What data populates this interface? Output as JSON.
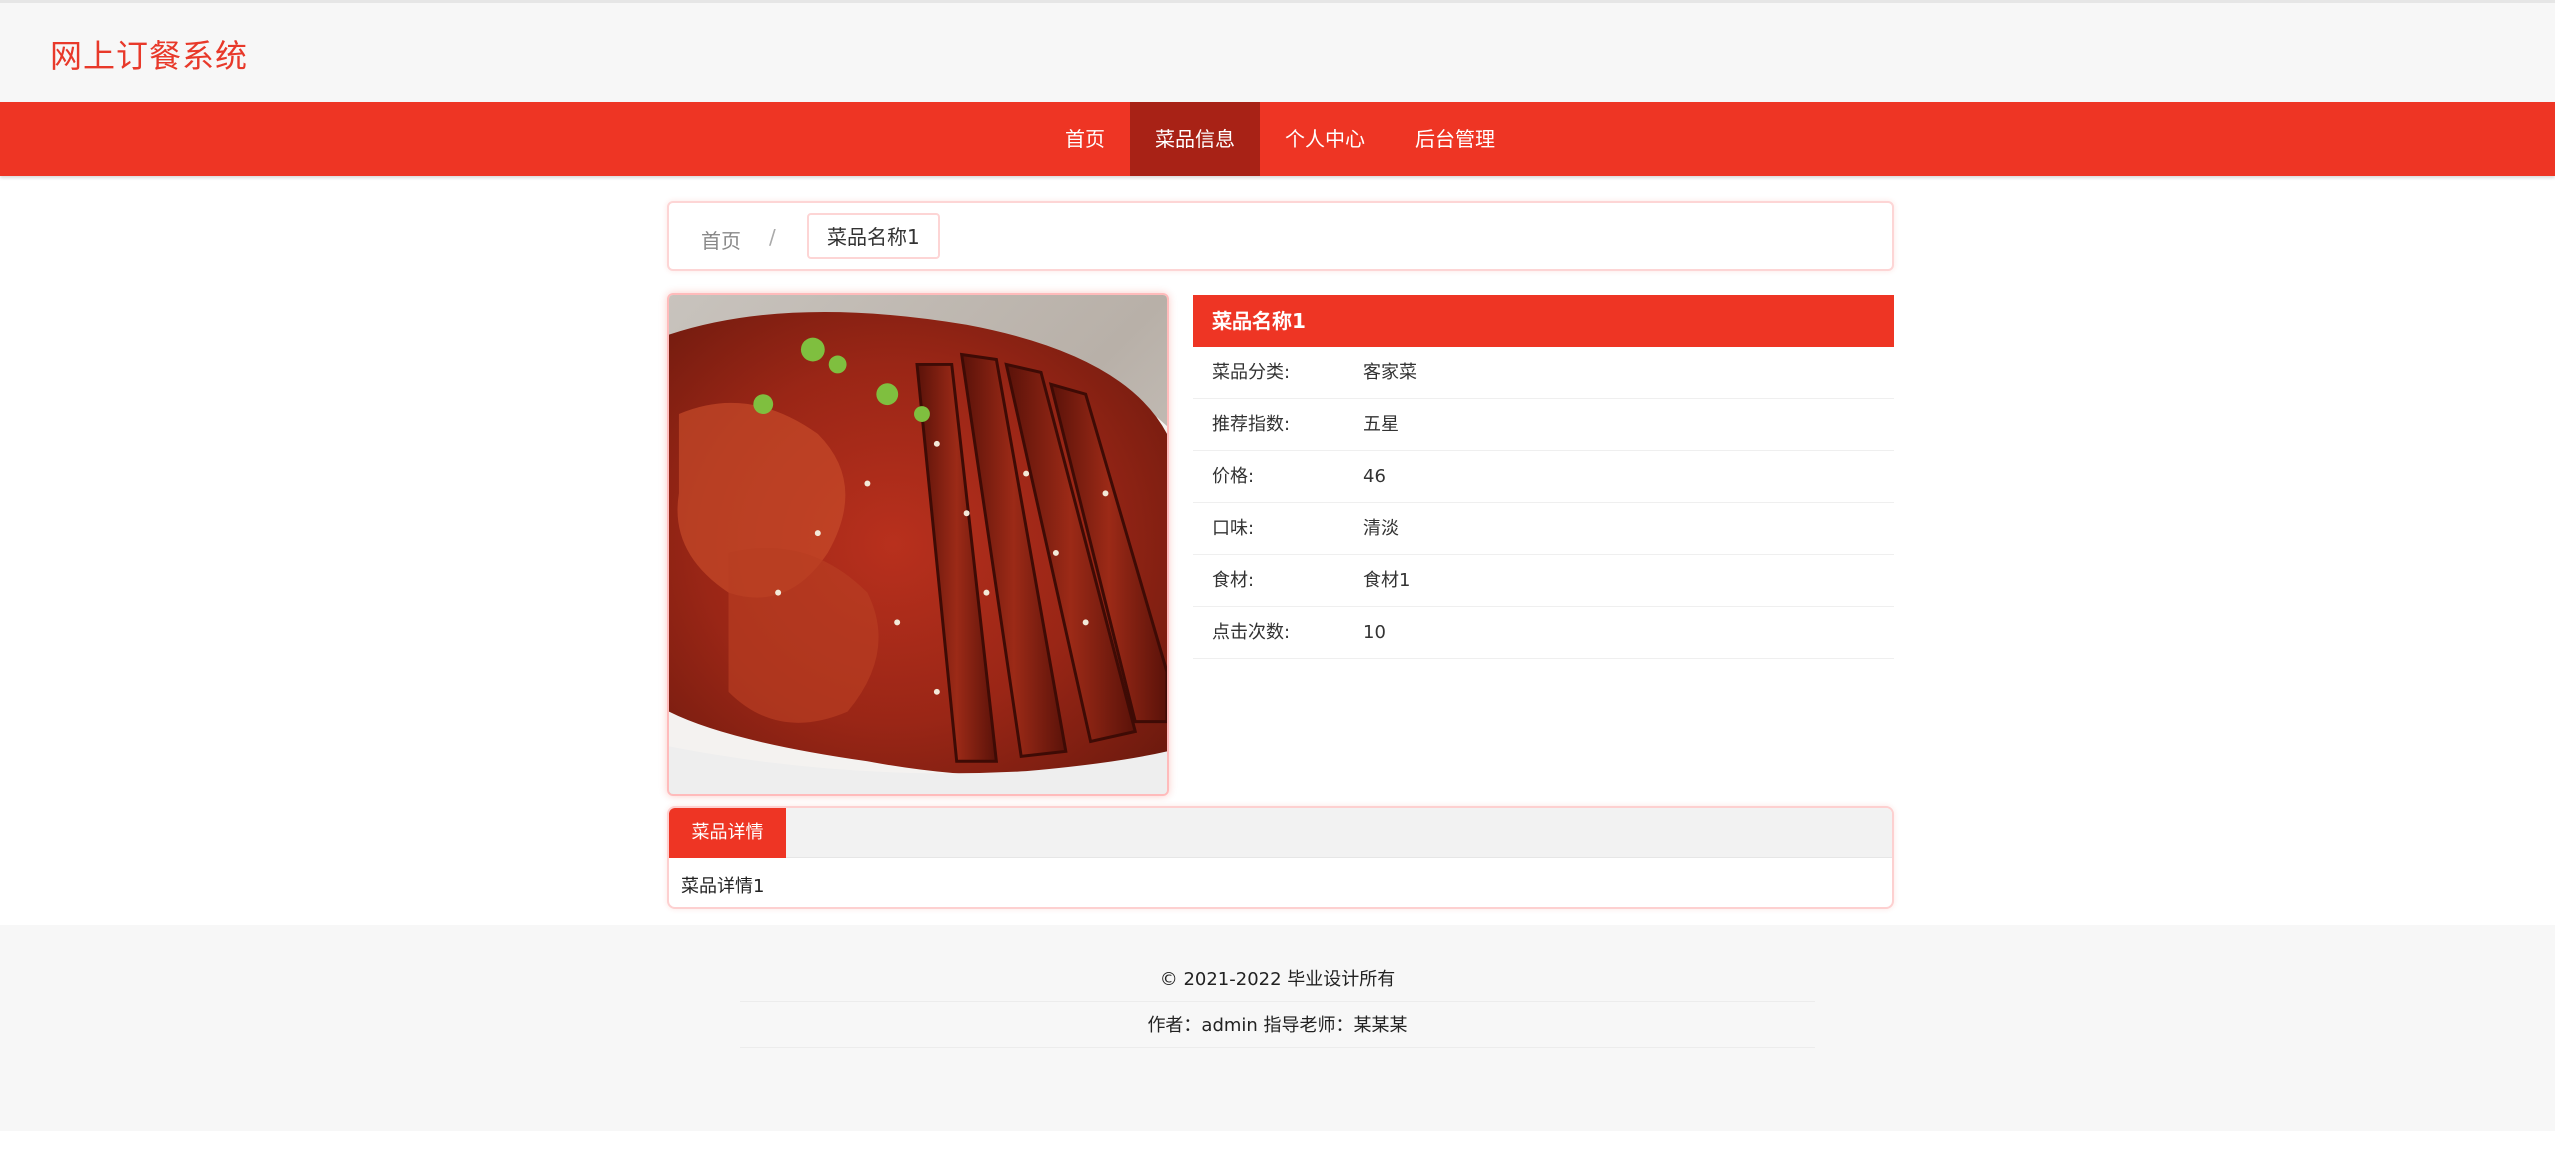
{
  "header": {
    "site_title": "网上订餐系统"
  },
  "nav": {
    "items": [
      {
        "label": "首页"
      },
      {
        "label": "菜品信息"
      },
      {
        "label": "个人中心"
      },
      {
        "label": "后台管理"
      }
    ],
    "active_index": 1
  },
  "breadcrumb": {
    "home": "首页",
    "separator": "/",
    "current": "菜品名称1"
  },
  "dish": {
    "name": "菜品名称1",
    "fields": [
      {
        "label": "菜品分类:",
        "value": "客家菜"
      },
      {
        "label": "推荐指数:",
        "value": "五星"
      },
      {
        "label": "价格:",
        "value": "46"
      },
      {
        "label": "口味:",
        "value": "清淡"
      },
      {
        "label": "食材:",
        "value": "食材1"
      },
      {
        "label": "点击次数:",
        "value": "10"
      }
    ]
  },
  "detail": {
    "tab_label": "菜品详情",
    "content": "菜品详情1"
  },
  "footer": {
    "copyright": "© 2021-2022 毕业设计所有",
    "credits": "作者：admin 指导老师：某某某"
  },
  "colors": {
    "accent": "#ee3524",
    "accent_dark": "#a82216",
    "title": "#e8392a"
  }
}
